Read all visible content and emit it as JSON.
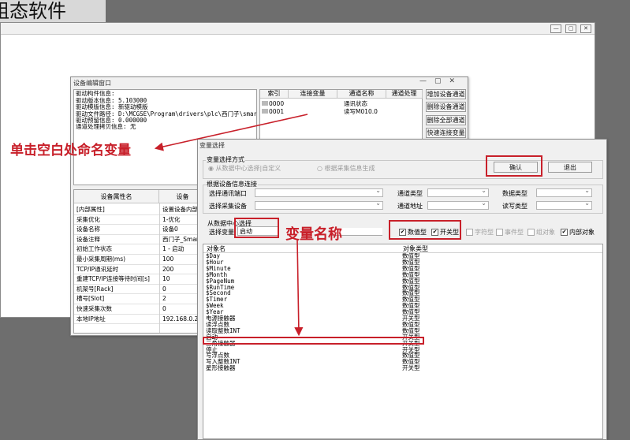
{
  "bg_title": "组态软件",
  "main_window": {
    "buttons": [
      "—",
      "▢",
      "✕"
    ]
  },
  "editor": {
    "title": "设备编辑窗口",
    "info_lines": [
      "驱动构件信息:",
      "驱动版本信息: 5.103000",
      "驱动模版信息: 新驱动模版",
      "驱动文件路径: D:\\MCGSE\\Program\\drivers\\plc\\西门子\\smart",
      "驱动预留信息: 0.000000",
      "通道处理拷贝信息: 无"
    ],
    "channel_table": {
      "headers": [
        "索引",
        "连接变量",
        "通道名称",
        "通道处理"
      ],
      "rows": [
        {
          "index": "0000",
          "var": "",
          "name": "通讯状态",
          "proc": ""
        },
        {
          "index": "0001",
          "var": "",
          "name": "读写M010.0",
          "proc": ""
        }
      ]
    },
    "side_buttons": [
      "增加设备通道",
      "删除设备通道",
      "删除全部通道",
      "快速连接变量"
    ],
    "prop_headers": [
      "设备属性名",
      "设备"
    ],
    "props": [
      {
        "name": "[内部属性]",
        "value": "设置设备内部"
      },
      {
        "name": "采集优化",
        "value": "1-优化"
      },
      {
        "name": "设备名称",
        "value": "设备0"
      },
      {
        "name": "设备注释",
        "value": "西门子_Smart"
      },
      {
        "name": "初始工作状态",
        "value": "1 - 启动"
      },
      {
        "name": "最小采集周期(ms)",
        "value": "100"
      },
      {
        "name": "TCP/IP通讯延时",
        "value": "200"
      },
      {
        "name": "重建TCP/IP连接等待时间[s]",
        "value": "10"
      },
      {
        "name": "机架号[Rack]",
        "value": "0"
      },
      {
        "name": "槽号[Slot]",
        "value": "2"
      },
      {
        "name": "快速采集次数",
        "value": "0"
      },
      {
        "name": "本地IP地址",
        "value": "192.168.0.2"
      }
    ]
  },
  "var_dialog": {
    "title": "变量选择",
    "mode_group": "变量选择方式",
    "mode_options": [
      "从数据中心选择|自定义",
      "根据采集信息生成"
    ],
    "confirm": "确认",
    "exit": "退出",
    "device_group": "根据设备信息连接",
    "labels": {
      "port": "选择通讯端口",
      "channel_type": "通道类型",
      "data_type": "数据类型",
      "device": "选择采集设备",
      "channel_addr": "通道地址",
      "rw_type": "读写类型",
      "from_data": "从数据中心选择",
      "select_var": "选择变量"
    },
    "select_var_value": "启动",
    "filters": [
      {
        "label": "数值型",
        "checked": true
      },
      {
        "label": "开关型",
        "checked": true
      },
      {
        "label": "字符型",
        "checked": false,
        "disabled": true
      },
      {
        "label": "事件型",
        "checked": false,
        "disabled": true
      },
      {
        "label": "组对象",
        "checked": false,
        "disabled": true
      },
      {
        "label": "内部对象",
        "checked": true
      }
    ],
    "list_headers": [
      "对象名",
      "对象类型"
    ],
    "objects": [
      {
        "name": "$Day",
        "type": "数值型"
      },
      {
        "name": "$Hour",
        "type": "数值型"
      },
      {
        "name": "$Minute",
        "type": "数值型"
      },
      {
        "name": "$Month",
        "type": "数值型"
      },
      {
        "name": "$PageNum",
        "type": "数值型"
      },
      {
        "name": "$RunTime",
        "type": "数值型"
      },
      {
        "name": "$Second",
        "type": "数值型"
      },
      {
        "name": "$Timer",
        "type": "数值型"
      },
      {
        "name": "$Week",
        "type": "数值型"
      },
      {
        "name": "$Year",
        "type": "数值型"
      },
      {
        "name": "电源接触器",
        "type": "开关型"
      },
      {
        "name": "读浮点数",
        "type": "数值型"
      },
      {
        "name": "读取整数INT",
        "type": "数值型"
      },
      {
        "name": "启动",
        "type": "开关型"
      },
      {
        "name": "三角接触器",
        "type": "开关型"
      },
      {
        "name": "停止",
        "type": "开关型"
      },
      {
        "name": "写浮点数",
        "type": "数值型"
      },
      {
        "name": "写入整数INT",
        "type": "数值型"
      },
      {
        "name": "星形接触器",
        "type": "开关型"
      }
    ]
  },
  "annotations": {
    "left": "单击空白处命名变量",
    "middle": "变量名称"
  }
}
